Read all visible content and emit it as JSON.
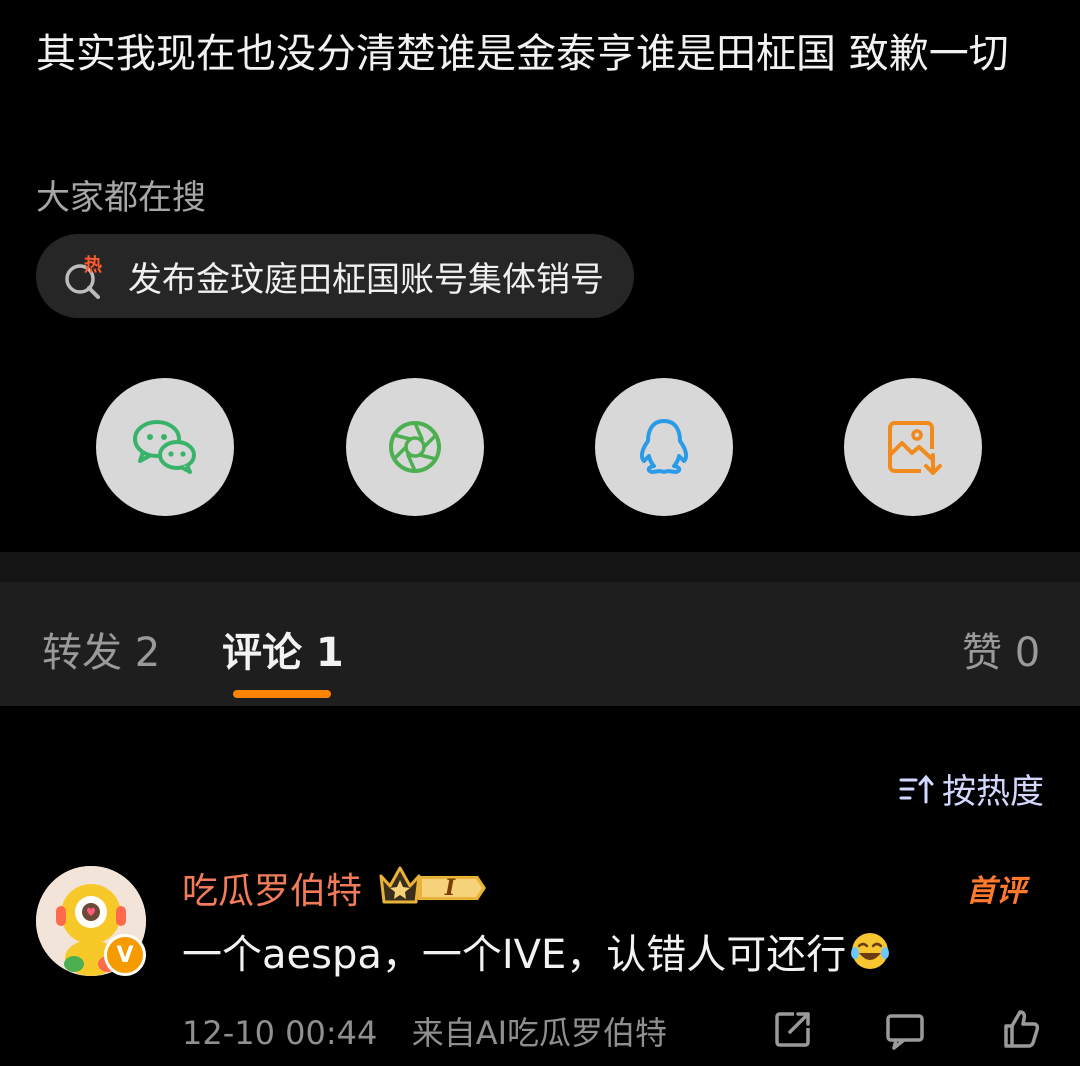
{
  "post": {
    "text": "其实我现在也没分清楚谁是金泰亨谁是田柾国 致歉一切"
  },
  "trending": {
    "label": "大家都在搜",
    "hot_tag": "热",
    "topic": "发布金玟庭田柾国账号集体销号"
  },
  "share_targets": [
    {
      "icon": "wechat-icon",
      "color": "#3ab36a"
    },
    {
      "icon": "moments-shutter-icon",
      "color": "#4caf50"
    },
    {
      "icon": "qq-penguin-icon",
      "color": "#2a9be8"
    },
    {
      "icon": "save-image-icon",
      "color": "#f08a1c"
    }
  ],
  "tabs": [
    {
      "label": "转发 2"
    },
    {
      "label": "评论 1"
    },
    {
      "label": "赞 0"
    }
  ],
  "accent": "#ff8200",
  "sort": {
    "label": "按热度",
    "icon": "sort-arrows-icon"
  },
  "comment": {
    "username": "吃瓜罗伯特",
    "level_badge": "I",
    "badge_label": "首评",
    "verified_mark": "V",
    "text": "一个aespa，一个IVE，认错人可还行",
    "time": "12-10 00:44",
    "source": "来自AI吃瓜罗伯特"
  }
}
